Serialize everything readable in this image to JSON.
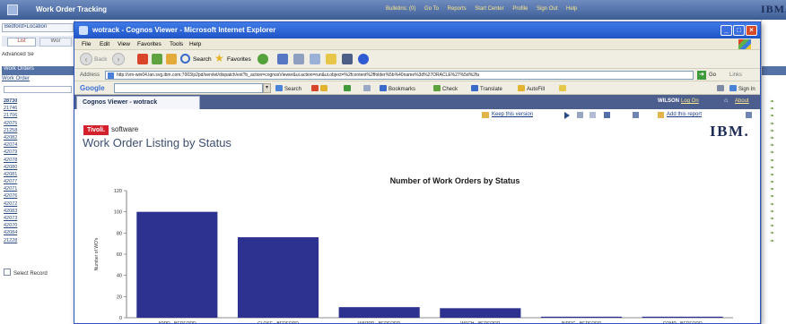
{
  "app": {
    "title": "Work Order Tracking",
    "links": [
      "Bulletins: (0)",
      "Go To",
      "Reports",
      "Start Center",
      "Profile",
      "Sign Out",
      "Help"
    ],
    "logo": "IBM."
  },
  "background_list": {
    "breadcrumb": "Bedford>Location",
    "tabs": [
      "List",
      "Wor"
    ],
    "advanced_search": "Advanced Se",
    "list_header": "Work Orders",
    "column_header": "Work Order",
    "rows": [
      "28730",
      "21746",
      "21706",
      "42075",
      "21258",
      "42082",
      "42074",
      "42079",
      "42078",
      "42080",
      "42081",
      "42077",
      "42071",
      "42076",
      "42072",
      "42083",
      "42073",
      "42070",
      "42084",
      "21228"
    ],
    "select_records": "Select Record"
  },
  "browser": {
    "title": "wotrack - Cognos Viewer - Microsoft Internet Explorer",
    "menu": [
      "File",
      "Edit",
      "View",
      "Favorites",
      "Tools",
      "Help"
    ],
    "toolbar": {
      "back": "Back",
      "search": "Search",
      "favorites": "Favorites"
    },
    "address_label": "Address",
    "address": "http://vm-win04.lan.svg.ibm.com:7003/p2pd/servlet/dispatch/ext?b_action=cognosViewer&ui.action=run&ui.object=%2fcontent%2ffolder%5b%40name%3d%27ORACLE%27%5d%2fa",
    "go": "Go",
    "links": "Links",
    "google": {
      "logo": "Google",
      "search": "Search",
      "bookmarks": "Bookmarks",
      "check": "Check",
      "translate": "Translate",
      "autofill": "AutoFill",
      "signin": "Sign In"
    },
    "tab_colors": [
      "#4285f4",
      "#db4437",
      "#f4b400",
      "#4285f4",
      "#0f9d58",
      "#db4437"
    ]
  },
  "viewer": {
    "tab": "Cognos Viewer - wotrack",
    "user": "WILSON",
    "logon": "Log On",
    "about": "About",
    "keep_version": "Keep this version",
    "add_report": "Add this report",
    "badge": "Tivoli.",
    "badge_suffix": "software",
    "logo": "IBM.",
    "report_title": "Work Order Listing by Status"
  },
  "chart_data": {
    "type": "bar",
    "title": "Number of Work Orders by Status",
    "ylabel": "Number of WO's",
    "xlabel": "",
    "categories": [
      "APPR - BEDFORD",
      "CLOSE - BEDFORD",
      "WAPPR - BEDFORD",
      "WSCH - BEDFORD",
      "INPRG - BEDFORD",
      "COMP - BEDFORD"
    ],
    "values": [
      100,
      76,
      10,
      9,
      1,
      1
    ],
    "ylim": [
      0,
      120
    ],
    "yticks": [
      0,
      20,
      40,
      60,
      80,
      100,
      120
    ],
    "bar_color": "#2d318f",
    "grid": false,
    "legend": "none"
  }
}
